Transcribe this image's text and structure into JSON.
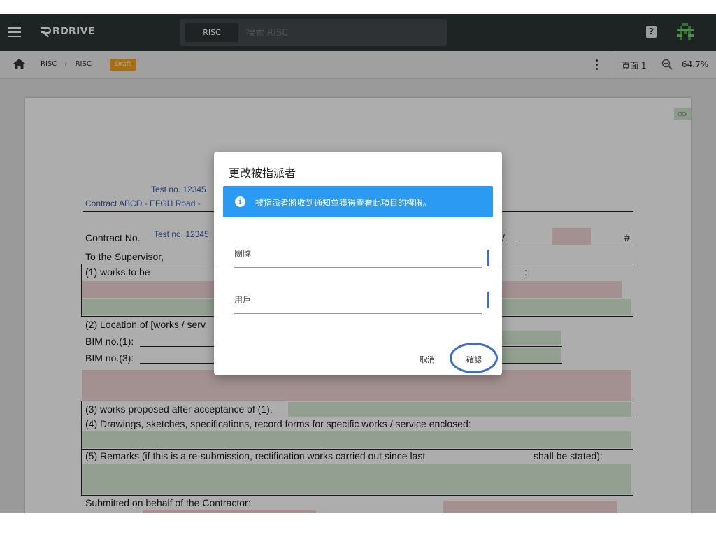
{
  "app": {
    "brand": "RDRIVE"
  },
  "search": {
    "scope": "RISC",
    "placeholder": "搜索 RISC"
  },
  "breadcrumb": {
    "items": [
      "RISC",
      "RISC"
    ],
    "separator": "›",
    "status_badge": "Draft"
  },
  "viewer": {
    "page_label": "頁面 1",
    "zoom": "64.7%"
  },
  "document": {
    "test_no_1": "Test no. 12345",
    "contract_line": "Contract ABCD - EFGH Road -",
    "contract_no_label": "Contract No.",
    "test_no_2": "Test no. 12345",
    "hash": "#",
    "dot": "/.",
    "to_supervisor": "To the Supervisor,",
    "works_to_be": "(1) works to be",
    "colon": ":",
    "location": "(2) Location of [works / serv",
    "bim1": "BIM no.(1):",
    "bim3": "BIM no.(3):",
    "item3": "(3) works proposed after acceptance of (1):",
    "item4": "(4) Drawings, sketches, specifications, record forms for specific works / service enclosed:",
    "item5": "(5) Remarks (if this is a re-submission, rectification works carried out since last",
    "item5_tail": "shall be stated):",
    "submitted": "Submitted on behalf of the Contractor:"
  },
  "dialog": {
    "title": "更改被指派者",
    "info": "被指派者將收到通知並獲得查看此項目的權限。",
    "team_label": "團隊",
    "user_label": "用戶",
    "cancel": "取消",
    "confirm": "確認"
  },
  "colors": {
    "info_banner": "#2b9af3",
    "focus_ring": "#3a6fd0",
    "draft_badge": "#f3a31b",
    "topbar": "#2d3436"
  }
}
